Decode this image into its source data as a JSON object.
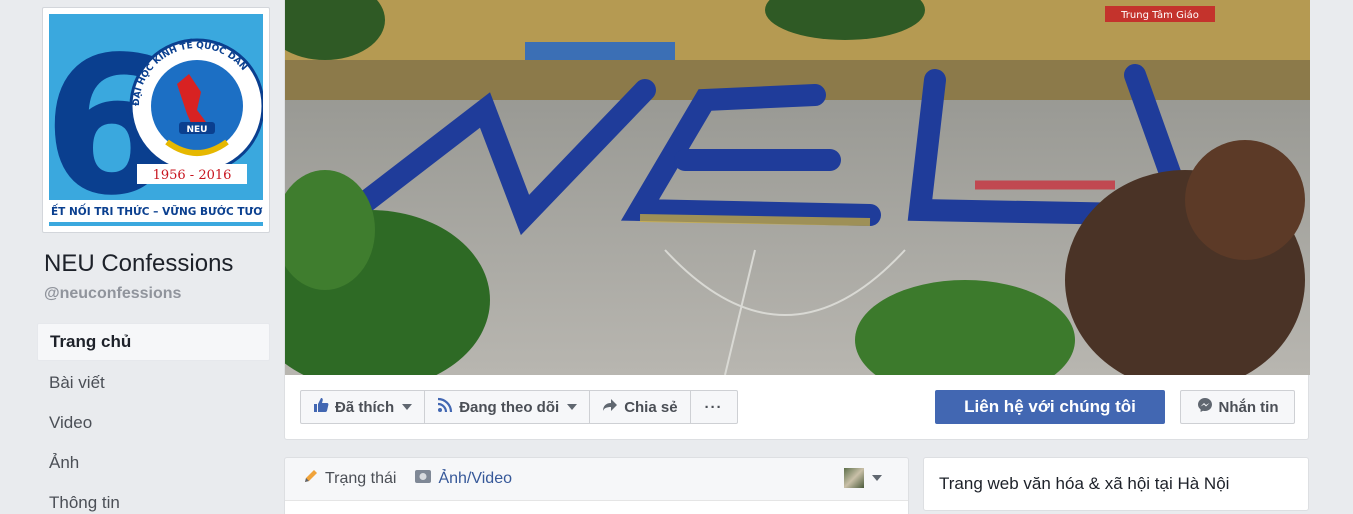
{
  "page": {
    "name": "NEU Confessions",
    "handle": "@neuconfessions"
  },
  "logo": {
    "number": "6",
    "arc_text": "ĐẠI HỌC KINH TẾ QUỐC DÂN",
    "badge_text": "NEU",
    "years": "1956 - 2016",
    "slogan": "ẾT NỐI TRI THỨC – VỮNG BƯỚC TƯƠNG L"
  },
  "cover": {
    "banner_text": "Trung Tâm Giáo"
  },
  "nav": {
    "items": [
      {
        "label": "Trang chủ",
        "active": true
      },
      {
        "label": "Bài viết",
        "active": false
      },
      {
        "label": "Video",
        "active": false
      },
      {
        "label": "Ảnh",
        "active": false
      },
      {
        "label": "Thông tin",
        "active": false
      }
    ]
  },
  "actions": {
    "liked": "Đã thích",
    "following": "Đang theo dõi",
    "share": "Chia sẻ",
    "more": "···",
    "contact": "Liên hệ với chúng tôi",
    "message": "Nhắn tin"
  },
  "composer": {
    "status": "Trạng thái",
    "photo_video": "Ảnh/Video"
  },
  "about": {
    "category": "Trang web văn hóa & xã hội tại Hà Nội"
  },
  "colors": {
    "primary": "#4267b2",
    "link": "#365899",
    "background": "#e9ebee",
    "logo_blue": "#2fa3dd",
    "logo_dark": "#0a3f8f"
  }
}
